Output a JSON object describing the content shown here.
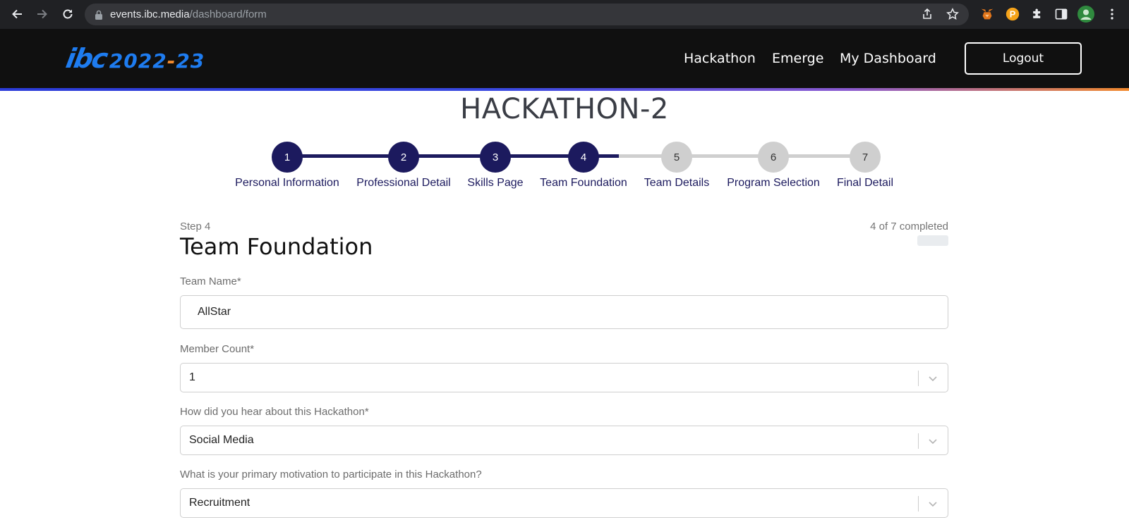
{
  "browser": {
    "url_host": "events.ibc.media",
    "url_path": "/dashboard/form"
  },
  "header": {
    "logo_ibc": "ibc",
    "logo_year_a": "2022",
    "logo_year_sep": "-",
    "logo_year_b": "23",
    "nav": [
      "Hackathon",
      "Emerge",
      "My Dashboard"
    ],
    "logout_label": "Logout",
    "accent_colors": [
      "#2b3bd8",
      "#f28a2e"
    ]
  },
  "page": {
    "title": "HACKATHON-2"
  },
  "stepper": {
    "current": 4,
    "total": 7,
    "steps": [
      {
        "num": "1",
        "label": "Personal Information",
        "done": true
      },
      {
        "num": "2",
        "label": "Professional Detail",
        "done": true
      },
      {
        "num": "3",
        "label": "Skills Page",
        "done": true
      },
      {
        "num": "4",
        "label": "Team Foundation",
        "done": true
      },
      {
        "num": "5",
        "label": "Team Details",
        "done": false
      },
      {
        "num": "6",
        "label": "Program Selection",
        "done": false
      },
      {
        "num": "7",
        "label": "Final Detail",
        "done": false
      }
    ],
    "done_color": "#1c1a5e",
    "todo_color": "#cfcfcf"
  },
  "form": {
    "step_label": "Step 4",
    "completed_text": "4 of 7 completed",
    "title": "Team Foundation",
    "team_name": {
      "label": "Team Name*",
      "value": "AllStar"
    },
    "member_count": {
      "label": "Member Count*",
      "value": "1"
    },
    "hear_about": {
      "label": "How did you hear about this Hackathon*",
      "value": "Social Media"
    },
    "motivation": {
      "label": "What is your primary motivation to participate in this Hackathon?",
      "value": "Recruitment"
    }
  }
}
